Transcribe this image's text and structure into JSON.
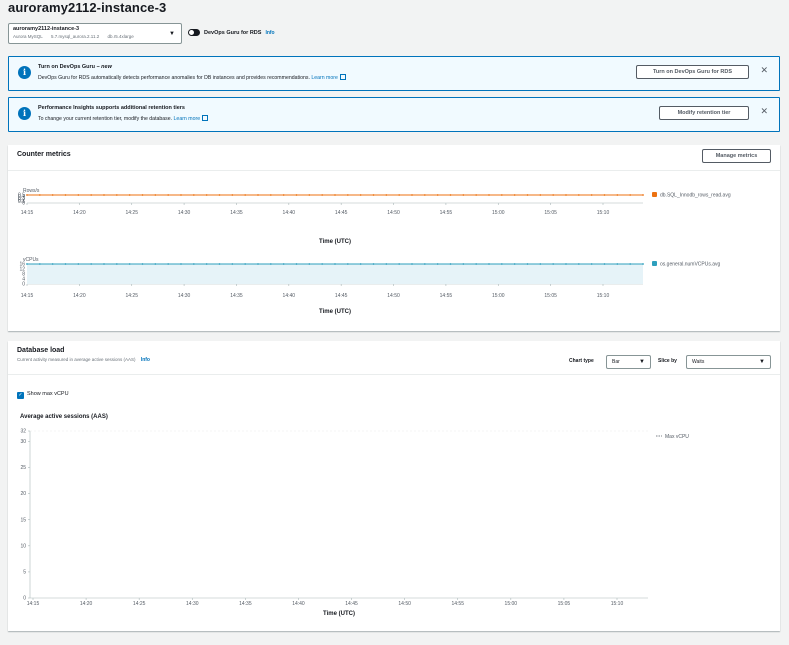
{
  "page": {
    "title": "auroramy2112-instance-3"
  },
  "instance_select": {
    "name": "auroramy2112-instance-3",
    "engine": "Aurora MySQL",
    "version": "5.7.mysql_aurora.2.11.2",
    "class": "db.r5.4xlarge"
  },
  "devops_toggle": {
    "label": "DevOps Guru for RDS",
    "info": "Info"
  },
  "flash_devops": {
    "title": "Turn on DevOps Guru",
    "title_suffix": " – new",
    "body": "DevOps Guru for RDS automatically detects performance anomalies for DB instances and provides recommendations.",
    "link": "Learn more",
    "button": "Turn on DevOps Guru for RDS"
  },
  "flash_retention": {
    "title": "Performance Insights supports additional retention tiers",
    "body": "To change your current retention tier, modify the database.",
    "link": "Learn more",
    "button": "Modify retention tier"
  },
  "counter_metrics": {
    "title": "Counter metrics",
    "manage_button": "Manage metrics"
  },
  "database_load": {
    "title": "Database load",
    "subtitle": "Current activity measured in average active sessions (AAS)",
    "info": "Info",
    "chart_type_label": "Chart type",
    "chart_type_value": "Bar",
    "slice_by_label": "Slice by",
    "slice_by_value": "Waits",
    "show_max_vcpu": "Show max vCPU",
    "aas_title": "Average active sessions (AAS)"
  },
  "colors": {
    "orange": "#ec7211",
    "blue": "#0073bb",
    "teal": "#2e9fbd"
  },
  "chart_data": [
    {
      "type": "line",
      "ylabel": "Rows/s",
      "xlabel": "Time (UTC)",
      "x": [
        "14:15",
        "14:20",
        "14:25",
        "14:30",
        "14:35",
        "14:40",
        "14:45",
        "14:50",
        "14:55",
        "15:00",
        "15:05",
        "15:10"
      ],
      "y_ticks": [
        "0.5",
        "0.4",
        "0.3",
        "0.2",
        "0.1",
        "0"
      ],
      "series": [
        {
          "name": "db.SQL_Innodb_rows_read.avg",
          "color": "#ec7211",
          "value": 0.5
        }
      ],
      "grid": false,
      "legend": "right"
    },
    {
      "type": "line",
      "ylabel": "vCPUs",
      "xlabel": "Time (UTC)",
      "x": [
        "14:15",
        "14:20",
        "14:25",
        "14:30",
        "14:35",
        "14:40",
        "14:45",
        "14:50",
        "14:55",
        "15:00",
        "15:05",
        "15:10"
      ],
      "y_ticks": [
        "16",
        "12",
        "8",
        "4",
        "0"
      ],
      "series": [
        {
          "name": "os.general.numVCPUs.avg",
          "color": "#2e9fbd",
          "value": 16
        }
      ],
      "grid": false,
      "legend": "right"
    },
    {
      "type": "bar",
      "ylabel": "Average active sessions (AAS)",
      "xlabel": "Time (UTC)",
      "x": [
        "14:15",
        "14:20",
        "14:25",
        "14:30",
        "14:35",
        "14:40",
        "14:45",
        "14:50",
        "14:55",
        "15:00",
        "15:05",
        "15:10"
      ],
      "y_ticks": [
        "32",
        "30",
        "25",
        "20",
        "15",
        "10",
        "5",
        "0"
      ],
      "ylim": [
        0,
        32
      ],
      "series": [
        {
          "name": "Max vCPU",
          "value": 32
        }
      ],
      "grid": false,
      "legend": "right"
    }
  ]
}
